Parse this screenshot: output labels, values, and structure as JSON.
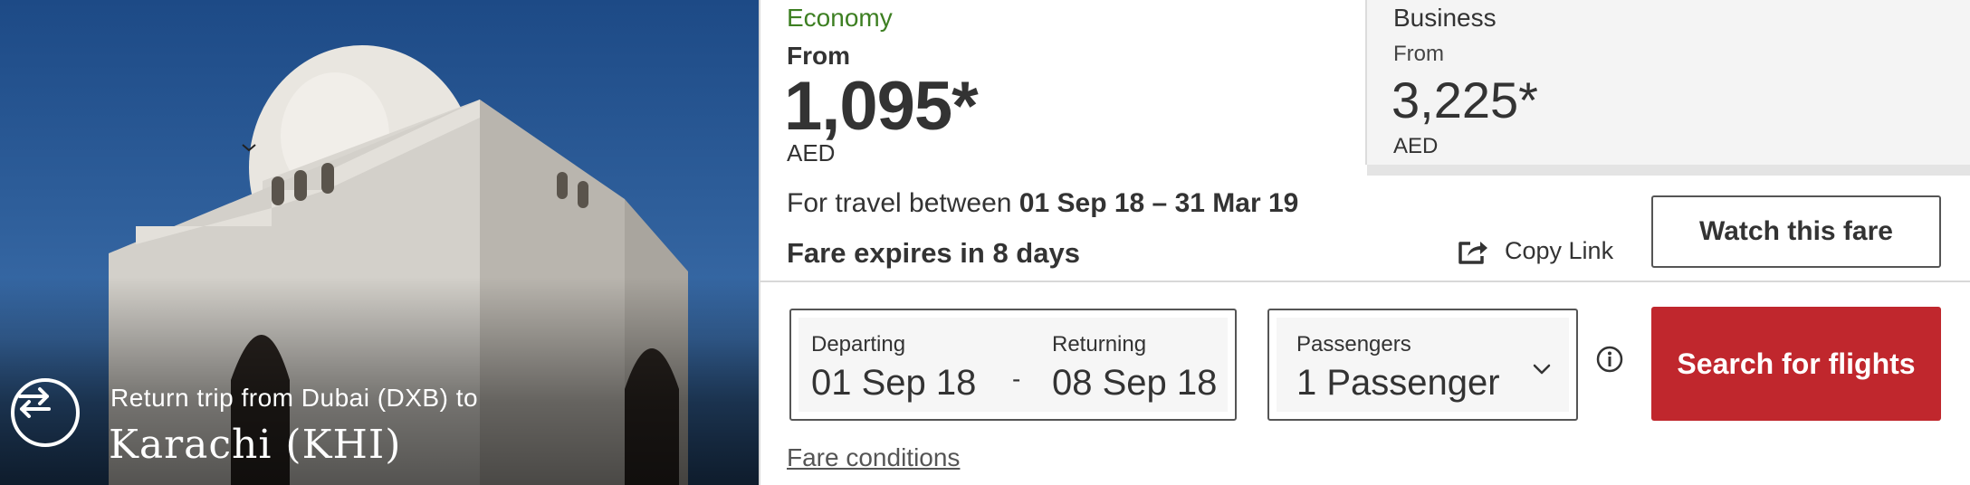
{
  "hero": {
    "subtitle": "Return trip from Dubai (DXB) to",
    "destination": "Karachi (KHI)",
    "icon": "return-trip-icon"
  },
  "economy": {
    "class_label": "Economy",
    "from_label": "From",
    "price": "1,095*",
    "currency": "AED"
  },
  "business": {
    "class_label": "Business",
    "from_label": "From",
    "price": "3,225*",
    "currency": "AED"
  },
  "travel": {
    "prefix": "For travel between",
    "range": "01 Sep 18 – 31 Mar 19"
  },
  "expiry": "Fare expires in 8 days",
  "actions": {
    "copy_link": "Copy Link",
    "watch_fare": "Watch this fare",
    "search": "Search for flights",
    "fare_conditions": "Fare conditions"
  },
  "search_form": {
    "departing_label": "Departing",
    "departing_value": "01 Sep 18",
    "separator": "-",
    "returning_label": "Returning",
    "returning_value": "08 Sep 18",
    "passengers_label": "Passengers",
    "passengers_value": "1 Passenger"
  },
  "colors": {
    "economy_green": "#3d7f22",
    "search_red": "#c0272d"
  }
}
